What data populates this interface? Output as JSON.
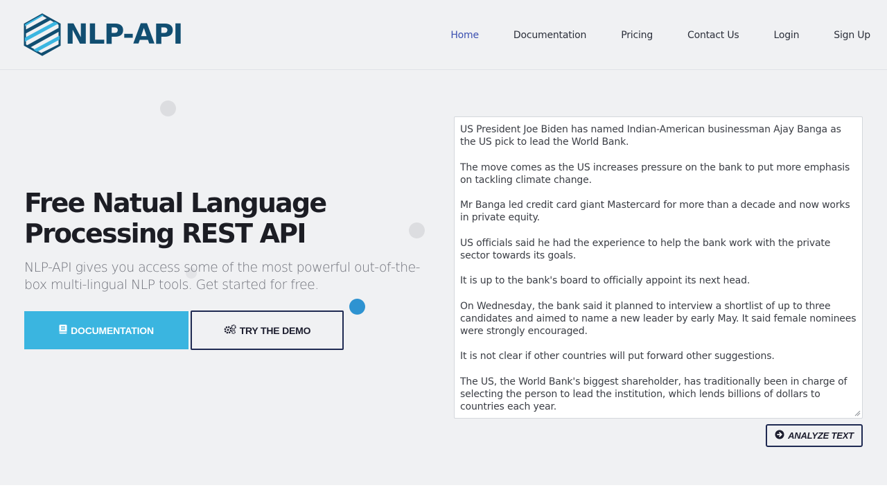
{
  "brand": {
    "name": "NLP-API",
    "logo_icon": "hexagon-stripes-logo",
    "colors": {
      "logo_dark": "#114e71",
      "logo_light": "#3ab5e0"
    }
  },
  "nav": {
    "items": [
      {
        "label": "Home",
        "active": true
      },
      {
        "label": "Documentation",
        "active": false
      },
      {
        "label": "Pricing",
        "active": false
      },
      {
        "label": "Contact Us",
        "active": false
      },
      {
        "label": "Login",
        "active": false
      },
      {
        "label": "Sign Up",
        "active": false
      }
    ],
    "active_color": "#3a4fb0"
  },
  "hero": {
    "title": "Free Natual Language Processing REST API",
    "subtitle": "NLP-API gives you access some of the most powerful out-of-the-box multi-lingual NLP tools. Get started for free.",
    "buttons": {
      "documentation": {
        "label": "DOCUMENTATION",
        "icon": "book-icon",
        "color": "#3ab5e0"
      },
      "demo": {
        "label": "TRY THE DEMO",
        "icon": "gears-icon"
      }
    }
  },
  "demo": {
    "text_paragraphs": [
      "US President Joe Biden has named Indian-American businessman Ajay Banga as the US pick to lead the World Bank.",
      "The move comes as the US increases pressure on the bank to put more emphasis on tackling climate change.",
      "Mr Banga led credit card giant Mastercard for more than a decade and now works in private equity.",
      "US officials said he had the experience to help the bank work with the private sector towards its goals.",
      "It is up to the bank's board to officially appoint its next head.",
      "On Wednesday, the bank said it planned to interview a shortlist of up to three candidates and aimed to name a new leader by early May. It said female nominees were strongly encouraged.",
      "It is not clear if other countries will put forward other suggestions.",
      "The US, the World Bank's biggest shareholder, has traditionally been in charge of selecting the person to lead the institution, which lends billions of dollars to countries each year."
    ],
    "analyze_button": {
      "label": "ANALYZE TEXT",
      "icon": "arrow-circle-right-icon"
    }
  }
}
